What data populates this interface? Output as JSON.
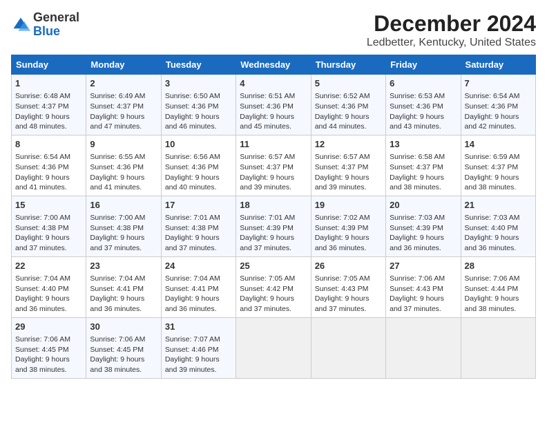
{
  "logo": {
    "general": "General",
    "blue": "Blue"
  },
  "title": "December 2024",
  "subtitle": "Ledbetter, Kentucky, United States",
  "days_of_week": [
    "Sunday",
    "Monday",
    "Tuesday",
    "Wednesday",
    "Thursday",
    "Friday",
    "Saturday"
  ],
  "weeks": [
    [
      {
        "day": "1",
        "sunrise": "Sunrise: 6:48 AM",
        "sunset": "Sunset: 4:37 PM",
        "daylight": "Daylight: 9 hours and 48 minutes."
      },
      {
        "day": "2",
        "sunrise": "Sunrise: 6:49 AM",
        "sunset": "Sunset: 4:37 PM",
        "daylight": "Daylight: 9 hours and 47 minutes."
      },
      {
        "day": "3",
        "sunrise": "Sunrise: 6:50 AM",
        "sunset": "Sunset: 4:36 PM",
        "daylight": "Daylight: 9 hours and 46 minutes."
      },
      {
        "day": "4",
        "sunrise": "Sunrise: 6:51 AM",
        "sunset": "Sunset: 4:36 PM",
        "daylight": "Daylight: 9 hours and 45 minutes."
      },
      {
        "day": "5",
        "sunrise": "Sunrise: 6:52 AM",
        "sunset": "Sunset: 4:36 PM",
        "daylight": "Daylight: 9 hours and 44 minutes."
      },
      {
        "day": "6",
        "sunrise": "Sunrise: 6:53 AM",
        "sunset": "Sunset: 4:36 PM",
        "daylight": "Daylight: 9 hours and 43 minutes."
      },
      {
        "day": "7",
        "sunrise": "Sunrise: 6:54 AM",
        "sunset": "Sunset: 4:36 PM",
        "daylight": "Daylight: 9 hours and 42 minutes."
      }
    ],
    [
      {
        "day": "8",
        "sunrise": "Sunrise: 6:54 AM",
        "sunset": "Sunset: 4:36 PM",
        "daylight": "Daylight: 9 hours and 41 minutes."
      },
      {
        "day": "9",
        "sunrise": "Sunrise: 6:55 AM",
        "sunset": "Sunset: 4:36 PM",
        "daylight": "Daylight: 9 hours and 41 minutes."
      },
      {
        "day": "10",
        "sunrise": "Sunrise: 6:56 AM",
        "sunset": "Sunset: 4:36 PM",
        "daylight": "Daylight: 9 hours and 40 minutes."
      },
      {
        "day": "11",
        "sunrise": "Sunrise: 6:57 AM",
        "sunset": "Sunset: 4:37 PM",
        "daylight": "Daylight: 9 hours and 39 minutes."
      },
      {
        "day": "12",
        "sunrise": "Sunrise: 6:57 AM",
        "sunset": "Sunset: 4:37 PM",
        "daylight": "Daylight: 9 hours and 39 minutes."
      },
      {
        "day": "13",
        "sunrise": "Sunrise: 6:58 AM",
        "sunset": "Sunset: 4:37 PM",
        "daylight": "Daylight: 9 hours and 38 minutes."
      },
      {
        "day": "14",
        "sunrise": "Sunrise: 6:59 AM",
        "sunset": "Sunset: 4:37 PM",
        "daylight": "Daylight: 9 hours and 38 minutes."
      }
    ],
    [
      {
        "day": "15",
        "sunrise": "Sunrise: 7:00 AM",
        "sunset": "Sunset: 4:38 PM",
        "daylight": "Daylight: 9 hours and 37 minutes."
      },
      {
        "day": "16",
        "sunrise": "Sunrise: 7:00 AM",
        "sunset": "Sunset: 4:38 PM",
        "daylight": "Daylight: 9 hours and 37 minutes."
      },
      {
        "day": "17",
        "sunrise": "Sunrise: 7:01 AM",
        "sunset": "Sunset: 4:38 PM",
        "daylight": "Daylight: 9 hours and 37 minutes."
      },
      {
        "day": "18",
        "sunrise": "Sunrise: 7:01 AM",
        "sunset": "Sunset: 4:39 PM",
        "daylight": "Daylight: 9 hours and 37 minutes."
      },
      {
        "day": "19",
        "sunrise": "Sunrise: 7:02 AM",
        "sunset": "Sunset: 4:39 PM",
        "daylight": "Daylight: 9 hours and 36 minutes."
      },
      {
        "day": "20",
        "sunrise": "Sunrise: 7:03 AM",
        "sunset": "Sunset: 4:39 PM",
        "daylight": "Daylight: 9 hours and 36 minutes."
      },
      {
        "day": "21",
        "sunrise": "Sunrise: 7:03 AM",
        "sunset": "Sunset: 4:40 PM",
        "daylight": "Daylight: 9 hours and 36 minutes."
      }
    ],
    [
      {
        "day": "22",
        "sunrise": "Sunrise: 7:04 AM",
        "sunset": "Sunset: 4:40 PM",
        "daylight": "Daylight: 9 hours and 36 minutes."
      },
      {
        "day": "23",
        "sunrise": "Sunrise: 7:04 AM",
        "sunset": "Sunset: 4:41 PM",
        "daylight": "Daylight: 9 hours and 36 minutes."
      },
      {
        "day": "24",
        "sunrise": "Sunrise: 7:04 AM",
        "sunset": "Sunset: 4:41 PM",
        "daylight": "Daylight: 9 hours and 36 minutes."
      },
      {
        "day": "25",
        "sunrise": "Sunrise: 7:05 AM",
        "sunset": "Sunset: 4:42 PM",
        "daylight": "Daylight: 9 hours and 37 minutes."
      },
      {
        "day": "26",
        "sunrise": "Sunrise: 7:05 AM",
        "sunset": "Sunset: 4:43 PM",
        "daylight": "Daylight: 9 hours and 37 minutes."
      },
      {
        "day": "27",
        "sunrise": "Sunrise: 7:06 AM",
        "sunset": "Sunset: 4:43 PM",
        "daylight": "Daylight: 9 hours and 37 minutes."
      },
      {
        "day": "28",
        "sunrise": "Sunrise: 7:06 AM",
        "sunset": "Sunset: 4:44 PM",
        "daylight": "Daylight: 9 hours and 38 minutes."
      }
    ],
    [
      {
        "day": "29",
        "sunrise": "Sunrise: 7:06 AM",
        "sunset": "Sunset: 4:45 PM",
        "daylight": "Daylight: 9 hours and 38 minutes."
      },
      {
        "day": "30",
        "sunrise": "Sunrise: 7:06 AM",
        "sunset": "Sunset: 4:45 PM",
        "daylight": "Daylight: 9 hours and 38 minutes."
      },
      {
        "day": "31",
        "sunrise": "Sunrise: 7:07 AM",
        "sunset": "Sunset: 4:46 PM",
        "daylight": "Daylight: 9 hours and 39 minutes."
      },
      null,
      null,
      null,
      null
    ]
  ]
}
